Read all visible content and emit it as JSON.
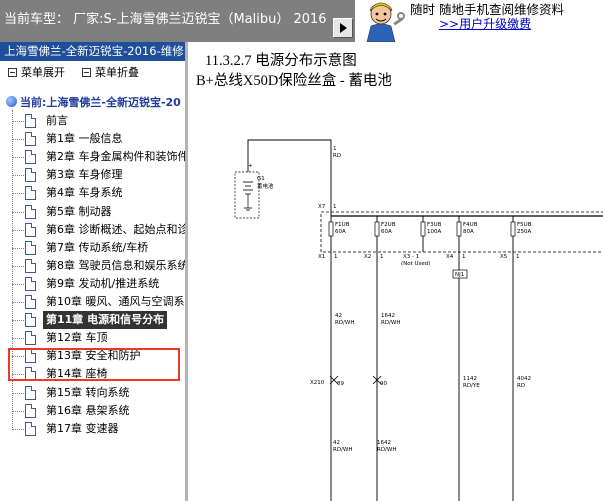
{
  "header": {
    "car_model": "当前车型： 厂家:S-上海雪佛兰迈锐宝（Malibu） 2016",
    "promo_text": "随时 随地手机查阅维修资料",
    "promo_link": ">>用户升级缴费"
  },
  "sidebar": {
    "title": "上海雪佛兰-全新迈锐宝-2016-维修",
    "expand_all": "菜单展开",
    "collapse_all": "菜单折叠",
    "current": "当前:上海雪佛兰-全新迈锐宝-20",
    "items": [
      {
        "label": "前言"
      },
      {
        "label": "第1章 一般信息"
      },
      {
        "label": "第2章 车身金属构件和装饰件"
      },
      {
        "label": "第3章 车身修理"
      },
      {
        "label": "第4章 车身系统"
      },
      {
        "label": "第5章 制动器"
      },
      {
        "label": "第6章 诊断概述、起始点和诊"
      },
      {
        "label": "第7章 传动系统/车桥"
      },
      {
        "label": "第8章 驾驶员信息和娱乐系统"
      },
      {
        "label": "第9章 发动机/推进系统"
      },
      {
        "label": "第10章 暖风、通风与空调系"
      },
      {
        "label": "第11章 电源和信号分布"
      },
      {
        "label": "第12章 车顶"
      },
      {
        "label": "第13章 安全和防护"
      },
      {
        "label": "第14章 座椅"
      },
      {
        "label": "第15章 转向系统"
      },
      {
        "label": "第16章 悬架系统"
      },
      {
        "label": "第17章 变速器"
      }
    ],
    "selected_index": 11
  },
  "main": {
    "section_title": "11.3.2.7 电源分布示意图",
    "section_subtitle": "B+总线X50D保险丝盒 - 蓄电池"
  },
  "schematic": {
    "battery_ref": "G1",
    "battery_label": "蓄电池",
    "top_wire_num": "1",
    "top_wire_color": "RD",
    "top_connector": "X7",
    "top_connector_pin": "1",
    "fuses": [
      {
        "name": "F1UB",
        "rating": "60A",
        "conn": "X1",
        "pin": "1",
        "wire_num": "42",
        "wire_color": "RD/WH"
      },
      {
        "name": "F2UB",
        "rating": "60A",
        "conn": "X2",
        "pin": "1",
        "wire_num": "1642",
        "wire_color": "RD/WH"
      },
      {
        "name": "F3UB",
        "rating": "100A",
        "conn": "X3 - 1",
        "note": "(Not Used)"
      },
      {
        "name": "F4UB",
        "rating": "80A",
        "conn": "X4",
        "pin": "1",
        "wire_num": "1142",
        "wire_color": "RD/YE",
        "junction": "NJ1"
      },
      {
        "name": "F5UB",
        "rating": "250A",
        "conn": "X5",
        "pin": "1",
        "wire_num": "4042",
        "wire_color": "RD"
      }
    ],
    "inline_connector": "X210",
    "inline_pins": [
      "89",
      "90"
    ],
    "lower_wires": [
      {
        "wire_num": "42",
        "wire_color": "RD/WH"
      },
      {
        "wire_num": "1642",
        "wire_color": "RD/WH"
      }
    ],
    "colors": {
      "wire": "#000000",
      "fuse_box": "#000000",
      "highlight": "#e8392d",
      "sidebar_header": "#1f4e9a"
    }
  }
}
